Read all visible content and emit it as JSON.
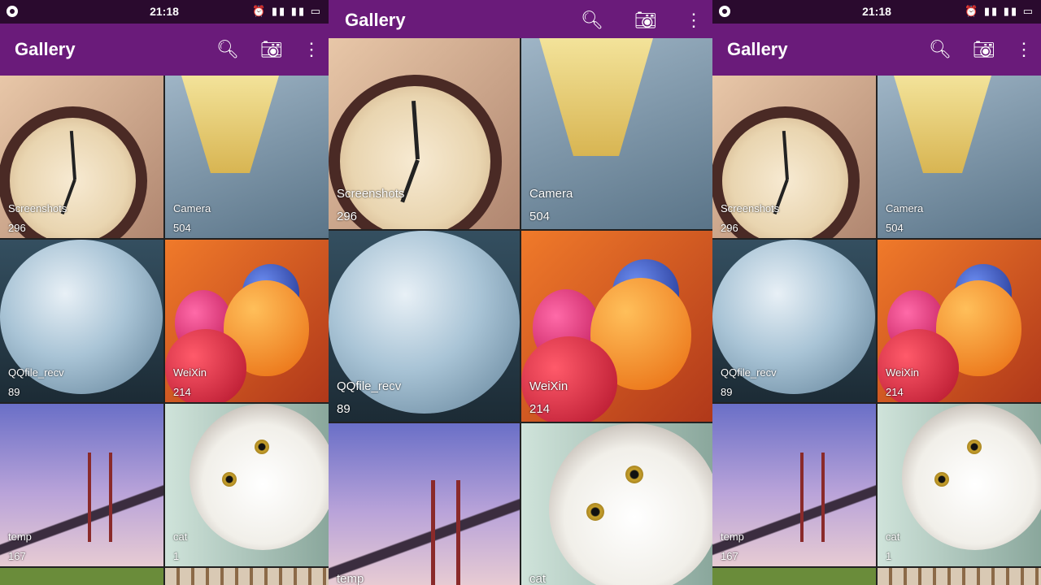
{
  "status": {
    "time": "21:18",
    "icons": "⏰ ▮▮ ▮▮ ▭"
  },
  "toolbar": {
    "title": "Gallery",
    "search_icon": "search-icon",
    "camera_icon": "camera-icon",
    "menu_icon": "more-vert-icon"
  },
  "albums": [
    {
      "name": "Screenshots",
      "count": "296"
    },
    {
      "name": "Camera",
      "count": "504"
    },
    {
      "name": "QQfile_recv",
      "count": "89"
    },
    {
      "name": "WeiXin",
      "count": "214"
    },
    {
      "name": "temp",
      "count": "167"
    },
    {
      "name": "cat",
      "count": "1"
    }
  ],
  "colors": {
    "toolbar": "#6a1b7a",
    "statusbar": "#2a0a2e",
    "accent": "#ffffff"
  }
}
